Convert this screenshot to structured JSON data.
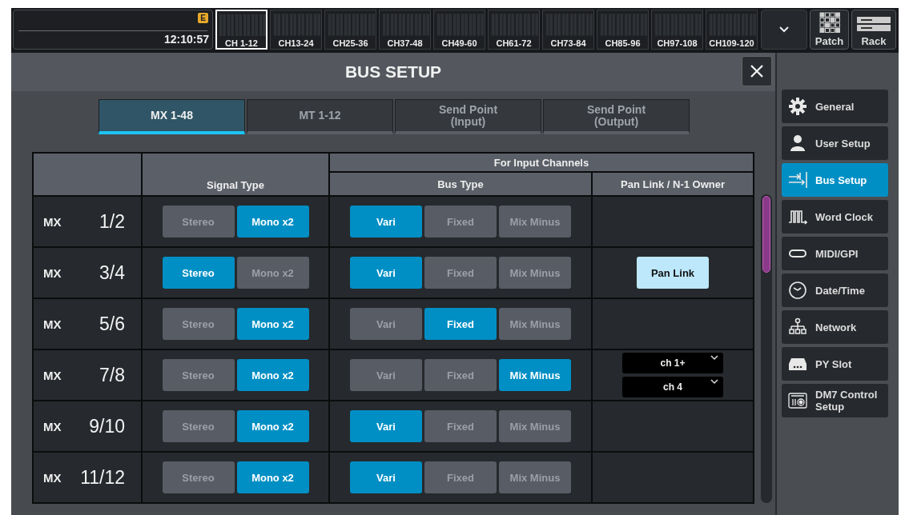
{
  "status": {
    "badge": "E",
    "time": "12:10:57"
  },
  "banks": [
    {
      "label": "CH 1-12",
      "selected": true
    },
    {
      "label": "CH13-24",
      "selected": false
    },
    {
      "label": "CH25-36",
      "selected": false
    },
    {
      "label": "CH37-48",
      "selected": false
    },
    {
      "label": "CH49-60",
      "selected": false
    },
    {
      "label": "CH61-72",
      "selected": false
    },
    {
      "label": "CH73-84",
      "selected": false
    },
    {
      "label": "CH85-96",
      "selected": false
    },
    {
      "label": "CH97-108",
      "selected": false
    },
    {
      "label": "CH109-120",
      "selected": false
    }
  ],
  "tools": [
    {
      "kind": "patch",
      "label": "Patch"
    },
    {
      "kind": "rack",
      "label": "Rack"
    }
  ],
  "dialog": {
    "title": "BUS SETUP",
    "tabs": [
      {
        "label": "MX 1-48",
        "selected": true
      },
      {
        "label": "MT 1-12",
        "selected": false
      },
      {
        "label": "Send Point\n(Input)",
        "selected": false
      },
      {
        "label": "Send Point\n(Output)",
        "selected": false
      }
    ],
    "table": {
      "group_header": "For Input Channels",
      "signal_header": "Signal Type",
      "bus_header": "Bus Type",
      "owner_header": "Pan Link / N-1 Owner",
      "rows": [
        {
          "prefix": "MX",
          "number": "1/2",
          "signal_type": [
            {
              "label": "Stereo",
              "selected": false
            },
            {
              "label": "Mono x2",
              "selected": true
            }
          ],
          "bus_type": [
            {
              "label": "Vari",
              "selected": true
            },
            {
              "label": "Fixed",
              "selected": false
            },
            {
              "label": "Mix Minus",
              "selected": false
            }
          ]
        },
        {
          "prefix": "MX",
          "number": "3/4",
          "signal_type": [
            {
              "label": "Stereo",
              "selected": true
            },
            {
              "label": "Mono x2",
              "selected": false
            }
          ],
          "bus_type": [
            {
              "label": "Vari",
              "selected": true
            },
            {
              "label": "Fixed",
              "selected": false
            },
            {
              "label": "Mix Minus",
              "selected": false
            }
          ],
          "pan_link": {
            "label": "Pan Link",
            "on": true
          }
        },
        {
          "prefix": "MX",
          "number": "5/6",
          "signal_type": [
            {
              "label": "Stereo",
              "selected": false
            },
            {
              "label": "Mono x2",
              "selected": true
            }
          ],
          "bus_type": [
            {
              "label": "Vari",
              "selected": false
            },
            {
              "label": "Fixed",
              "selected": true
            },
            {
              "label": "Mix Minus",
              "selected": false
            }
          ]
        },
        {
          "prefix": "MX",
          "number": "7/8",
          "signal_type": [
            {
              "label": "Stereo",
              "selected": false
            },
            {
              "label": "Mono x2",
              "selected": true
            }
          ],
          "bus_type": [
            {
              "label": "Vari",
              "selected": false
            },
            {
              "label": "Fixed",
              "selected": false
            },
            {
              "label": "Mix Minus",
              "selected": true
            }
          ],
          "n1_owner": [
            "ch 1+",
            "ch 4"
          ]
        },
        {
          "prefix": "MX",
          "number": "9/10",
          "signal_type": [
            {
              "label": "Stereo",
              "selected": false
            },
            {
              "label": "Mono x2",
              "selected": true
            }
          ],
          "bus_type": [
            {
              "label": "Vari",
              "selected": true
            },
            {
              "label": "Fixed",
              "selected": false
            },
            {
              "label": "Mix Minus",
              "selected": false
            }
          ]
        },
        {
          "prefix": "MX",
          "number": "11/12",
          "signal_type": [
            {
              "label": "Stereo",
              "selected": false
            },
            {
              "label": "Mono x2",
              "selected": true
            }
          ],
          "bus_type": [
            {
              "label": "Vari",
              "selected": true
            },
            {
              "label": "Fixed",
              "selected": false
            },
            {
              "label": "Mix Minus",
              "selected": false
            }
          ]
        }
      ]
    }
  },
  "sidebar": {
    "items": [
      {
        "kind": "general",
        "label": "General",
        "selected": false
      },
      {
        "kind": "user",
        "label": "User Setup",
        "selected": false
      },
      {
        "kind": "bus",
        "label": "Bus Setup",
        "selected": true
      },
      {
        "kind": "wordclock",
        "label": "Word Clock",
        "selected": false
      },
      {
        "kind": "midi",
        "label": "MIDI/GPI",
        "selected": false
      },
      {
        "kind": "datetime",
        "label": "Date/Time",
        "selected": false
      },
      {
        "kind": "network",
        "label": "Network",
        "selected": false
      },
      {
        "kind": "slot",
        "label": "PY Slot",
        "selected": false
      },
      {
        "kind": "control",
        "label": "DM7 Control\nSetup",
        "selected": false
      }
    ]
  }
}
